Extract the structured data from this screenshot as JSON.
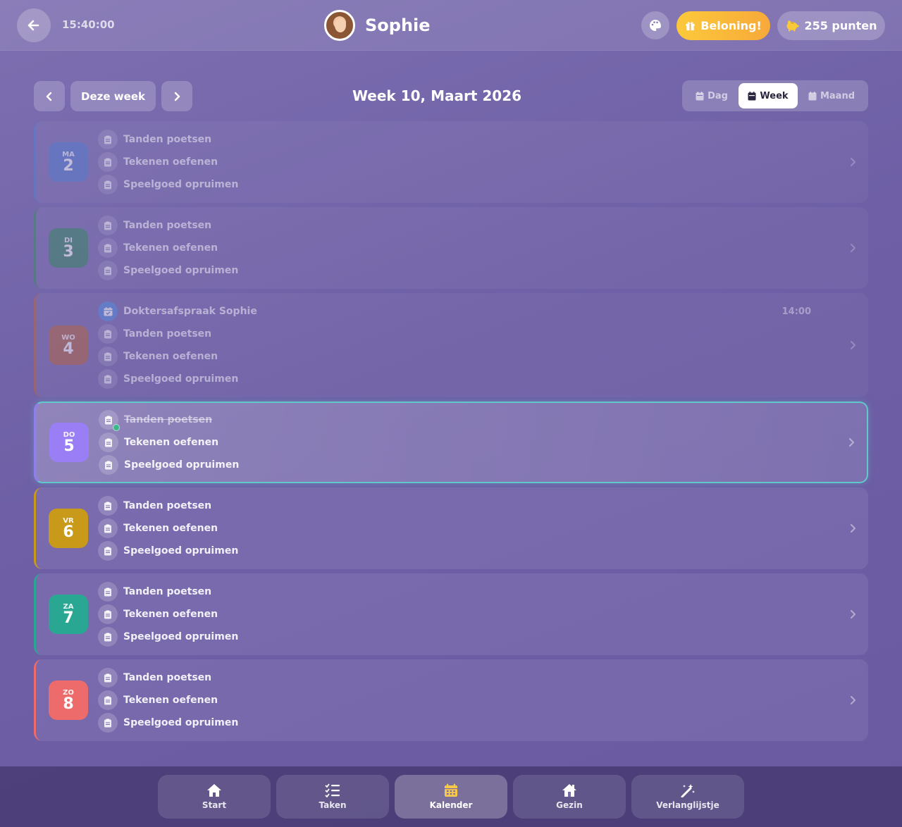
{
  "header": {
    "time": "15:40:00",
    "profile_name": "Sophie",
    "reward_label": "Beloning!",
    "points_label": "255 punten"
  },
  "toolbar": {
    "this_week_label": "Deze week",
    "week_title": "Week 10, Maart 2026",
    "views": [
      "Dag",
      "Week",
      "Maand"
    ],
    "active_view": "Week"
  },
  "days": [
    {
      "dow": "MA",
      "num": "2",
      "color": "#5a7fd0",
      "state": "past",
      "items": [
        "Tanden poetsen",
        "Tekenen oefenen",
        "Speelgoed opruimen"
      ]
    },
    {
      "dow": "DI",
      "num": "3",
      "color": "#3f8a6a",
      "state": "past",
      "items": [
        "Tanden poetsen",
        "Tekenen oefenen",
        "Speelgoed opruimen"
      ]
    },
    {
      "dow": "WO",
      "num": "4",
      "color": "#b56a4c",
      "state": "past",
      "event": {
        "label": "Doktersafspraak Sophie",
        "time": "14:00"
      },
      "items": [
        "Tanden poetsen",
        "Tekenen oefenen",
        "Speelgoed opruimen"
      ]
    },
    {
      "dow": "DO",
      "num": "5",
      "color": "#9a7ef5",
      "state": "today",
      "items": [
        "Tanden poetsen",
        "Tekenen oefenen",
        "Speelgoed opruimen"
      ]
    },
    {
      "dow": "VR",
      "num": "6",
      "color": "#c99a1a",
      "state": "future",
      "items": [
        "Tanden poetsen",
        "Tekenen oefenen",
        "Speelgoed opruimen"
      ]
    },
    {
      "dow": "ZA",
      "num": "7",
      "color": "#2aa792",
      "state": "future",
      "items": [
        "Tanden poetsen",
        "Tekenen oefenen",
        "Speelgoed opruimen"
      ]
    },
    {
      "dow": "ZO",
      "num": "8",
      "color": "#ee6b6b",
      "state": "future",
      "items": [
        "Tanden poetsen",
        "Tekenen oefenen",
        "Speelgoed opruimen"
      ]
    }
  ],
  "bottom_nav": {
    "tabs": [
      "Start",
      "Taken",
      "Kalender",
      "Gezin",
      "Verlanglijstje"
    ],
    "active": "Kalender"
  },
  "colors": {
    "reward_gradient": [
      "#fcc93b",
      "#f7a93a"
    ],
    "today_border": "#61c7c9",
    "calendar_accent": "#f6c94a"
  }
}
